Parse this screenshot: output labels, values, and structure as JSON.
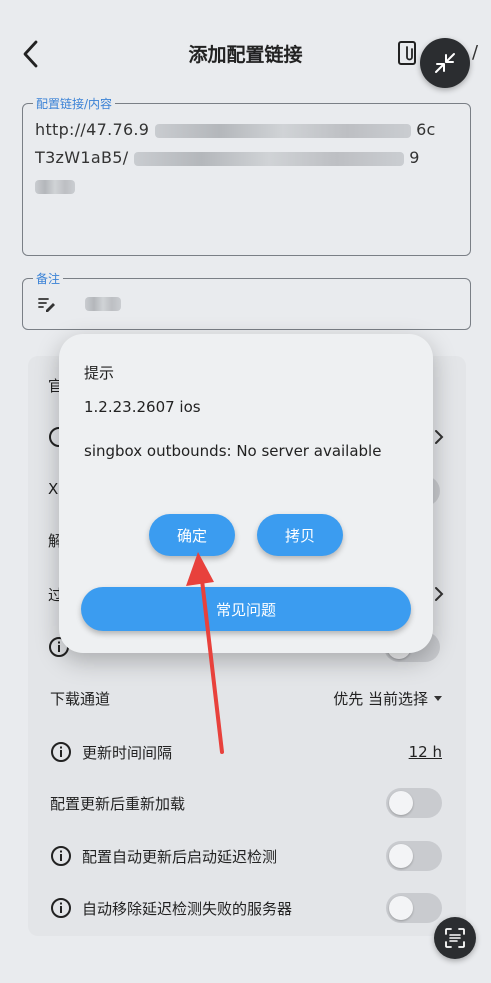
{
  "header": {
    "title": "添加配置链接",
    "extra_glyph": "/"
  },
  "link_field": {
    "label": "配置链接/内容",
    "line1_visible": "http://47.76.9",
    "line1_end": "6c",
    "line2_visible": "T3zW1aB5/",
    "line2_end": "9"
  },
  "note_field": {
    "label": "备注"
  },
  "partial_rows": {
    "r1": "官",
    "r3": "X",
    "r4": "解",
    "r5": "过"
  },
  "settings": {
    "download_channel_label": "下载通道",
    "download_channel_value": "优先 当前选择",
    "update_interval_label": "更新时间间隔",
    "update_interval_value": "12 h",
    "reload_after_update_label": "配置更新后重新加载",
    "latency_test_after_update_label": "配置自动更新后启动延迟检测",
    "remove_failed_servers_label": "自动移除延迟检测失败的服务器"
  },
  "dialog": {
    "title": "提示",
    "version": "1.2.23.2607 ios",
    "message": "singbox outbounds: No server available",
    "ok_label": "确定",
    "copy_label": "拷贝",
    "faq_label": "常见问题"
  },
  "colors": {
    "primary_button": "#3b9cf0",
    "arrow": "#e8413c",
    "fab": "#2b2d30",
    "label_accent": "#3a82d6"
  }
}
